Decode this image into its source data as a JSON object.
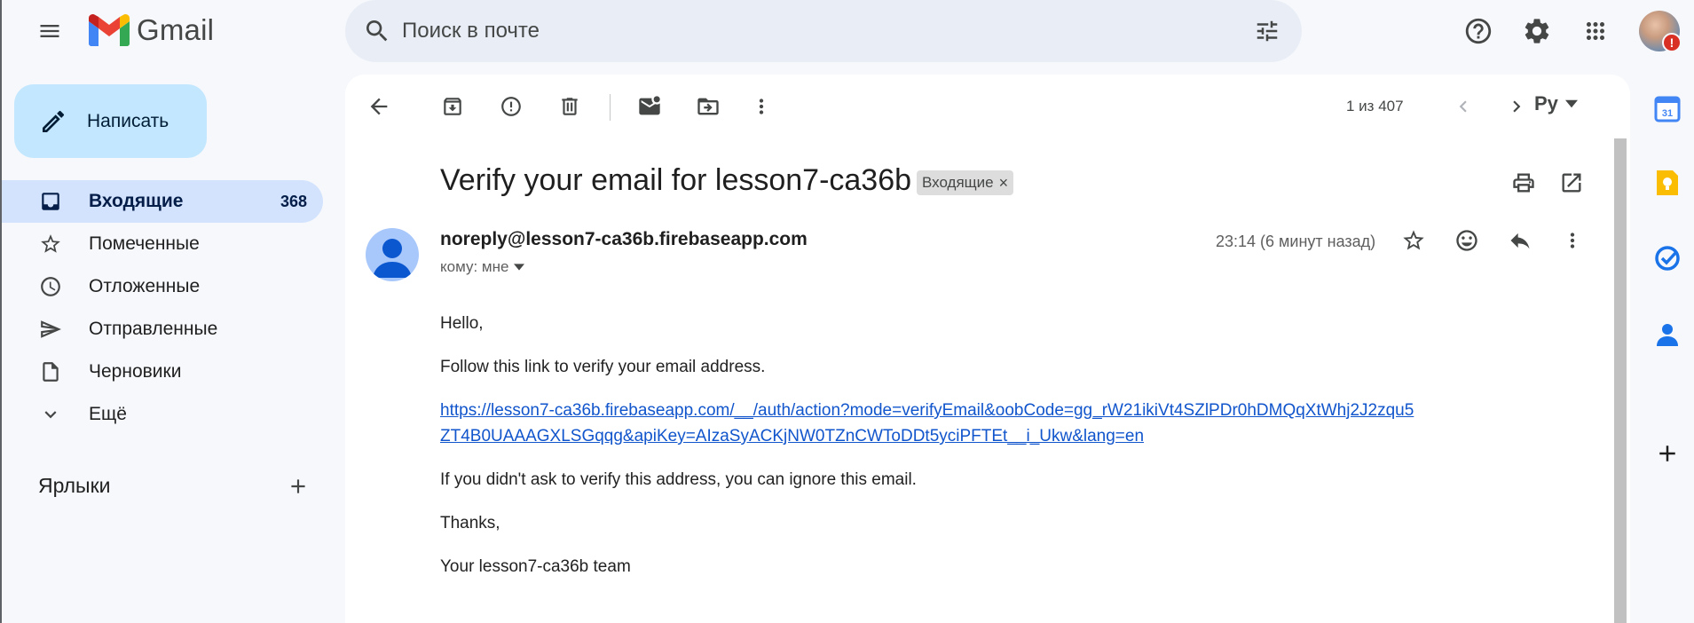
{
  "header": {
    "logo_text": "Gmail",
    "search_placeholder": "Поиск в почте"
  },
  "sidebar": {
    "compose_label": "Написать",
    "items": [
      {
        "label": "Входящие",
        "count": "368",
        "icon": "inbox-icon",
        "active": true
      },
      {
        "label": "Помеченные",
        "icon": "star-icon"
      },
      {
        "label": "Отложенные",
        "icon": "clock-icon"
      },
      {
        "label": "Отправленные",
        "icon": "send-icon"
      },
      {
        "label": "Черновики",
        "icon": "draft-icon"
      },
      {
        "label": "Ещё",
        "icon": "chevron-down-icon"
      }
    ],
    "labels_header": "Ярлыки"
  },
  "toolbar": {
    "pager": "1 из 407",
    "lang": "Ру"
  },
  "message": {
    "subject": "Verify your email for lesson7-ca36b",
    "label_chip": "Входящие",
    "sender": "noreply@lesson7-ca36b.firebaseapp.com",
    "recipient": "кому: мне",
    "time": "23:14 (6 минут назад)",
    "body": {
      "greeting": "Hello,",
      "line1": "Follow this link to verify your email address.",
      "link": "https://lesson7-ca36b.firebaseapp.com/__/auth/action?mode=verifyEmail&oobCode=gg_rW21ikiVt4SZlPDr0hDMQqXtWhj2J2zqu5ZT4B0UAAAGXLSGqqg&apiKey=AIzaSyACKjNW0TZnCWToDDt5yciPFTEt__i_Ukw&lang=en",
      "line2": "If you didn't ask to verify this address, you can ignore this email.",
      "thanks": "Thanks,",
      "signature": "Your lesson7-ca36b team"
    }
  },
  "colors": {
    "background": "#f6f8fc",
    "compose": "#c2e7ff",
    "active_nav": "#d3e3fd",
    "link": "#1155cc"
  },
  "side_apps": [
    "calendar-icon",
    "keep-icon",
    "tasks-icon",
    "contacts-icon",
    "add-icon"
  ]
}
